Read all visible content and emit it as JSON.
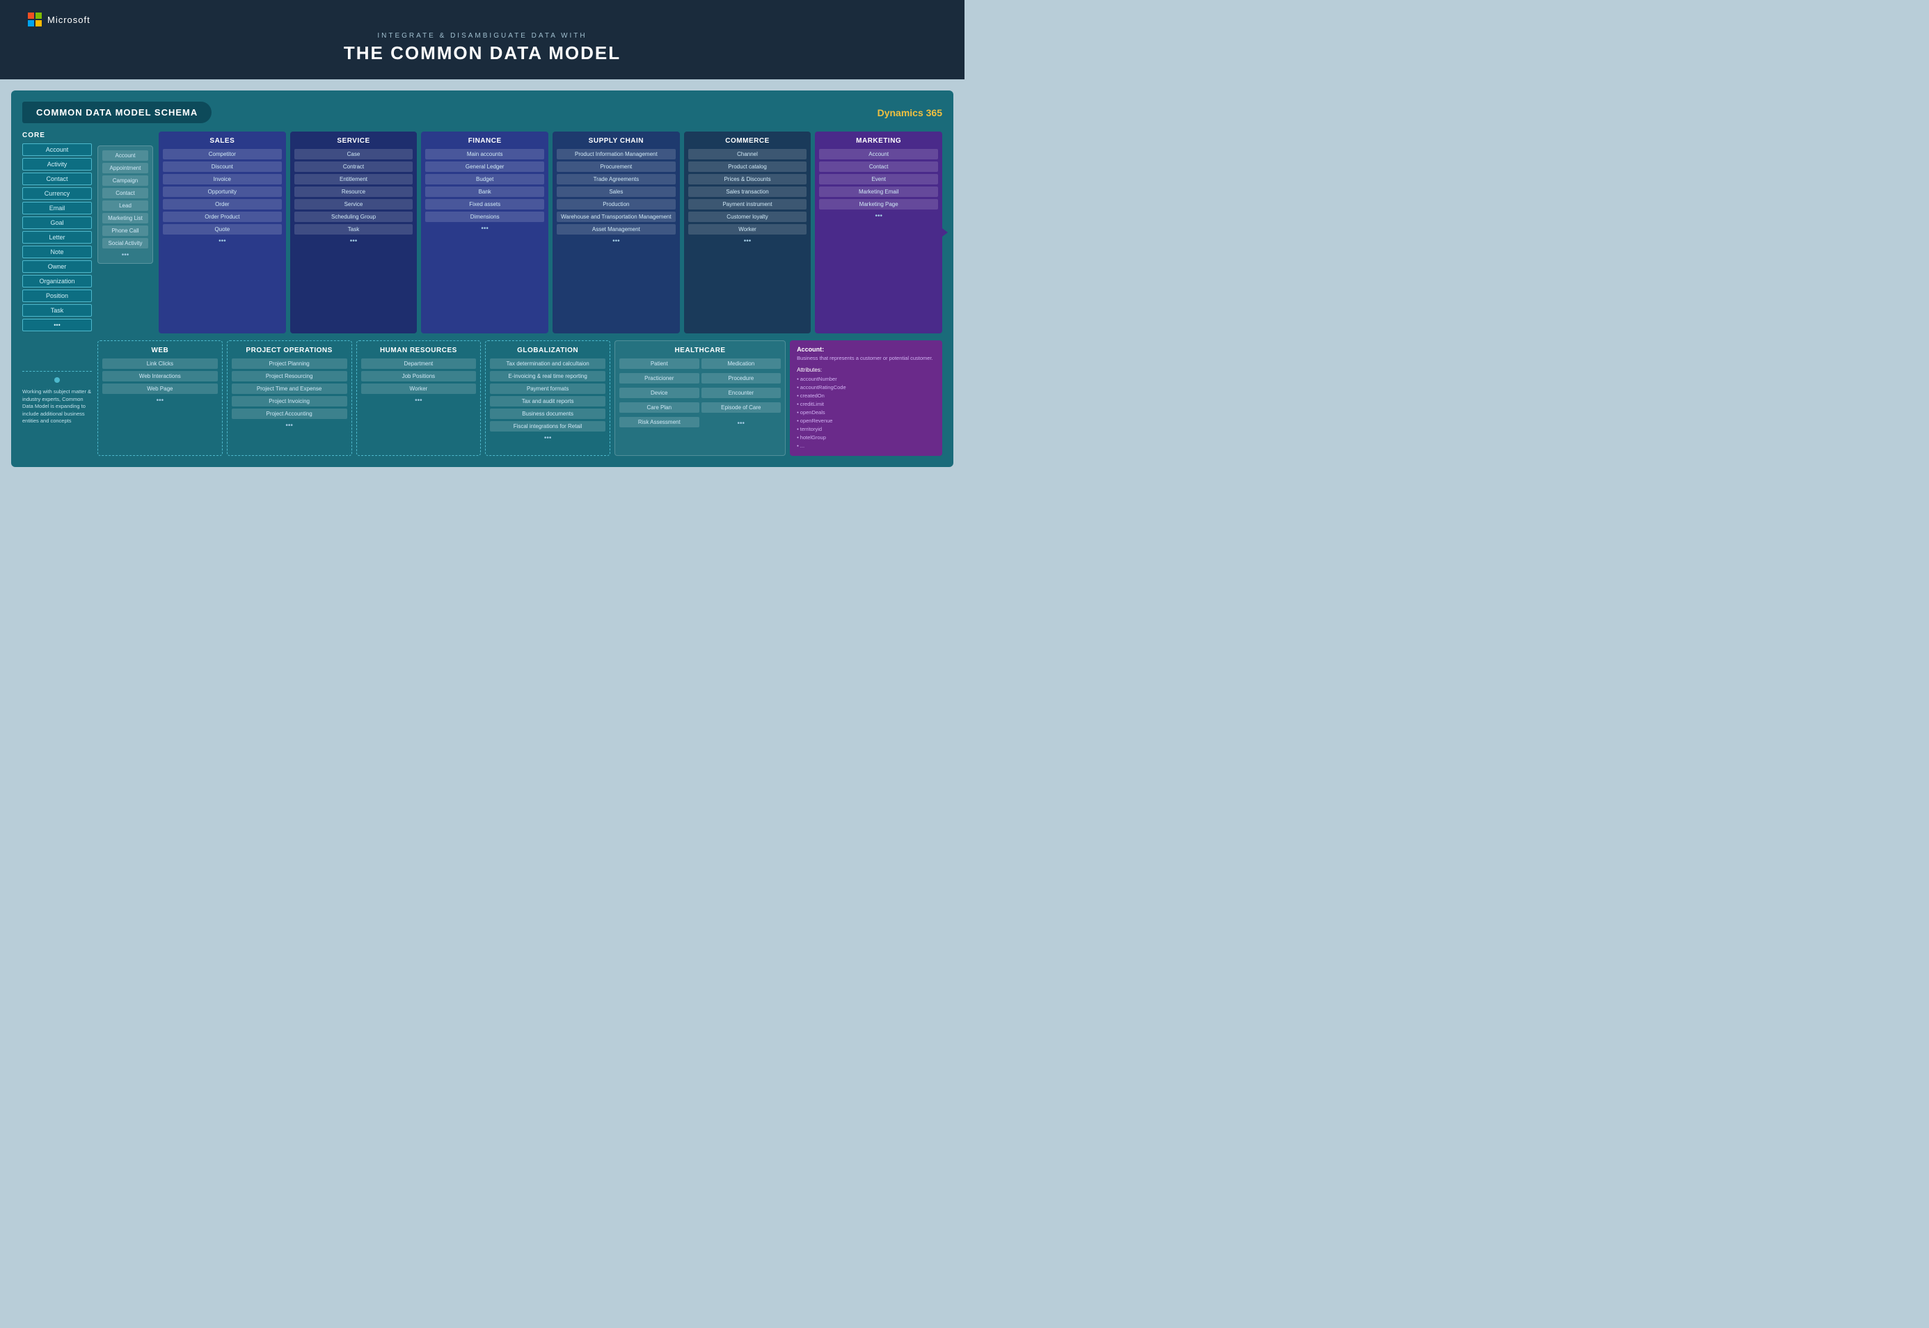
{
  "header": {
    "brand": "Microsoft",
    "subtitle": "Integrate & Disambiguate Data With",
    "title": "The Common Data Model"
  },
  "schema": {
    "title": "COMMON DATA MODEL SCHEMA",
    "dynamics_label": "Dynamics 365"
  },
  "core": {
    "label": "CORE",
    "items": [
      "Account",
      "Activity",
      "Contact",
      "Currency",
      "Email",
      "Goal",
      "Letter",
      "Note",
      "Owner",
      "Organization",
      "Position",
      "Task",
      "..."
    ]
  },
  "cds_base": {
    "items": [
      "Account",
      "Appointment",
      "Campaign",
      "Contact",
      "Lead",
      "Marketing List",
      "Phone Call",
      "Social Activity",
      "..."
    ]
  },
  "sales": {
    "title": "SALES",
    "items": [
      "Competitor",
      "Discount",
      "Invoice",
      "Opportunity",
      "Order",
      "Order Product",
      "Quote",
      "..."
    ]
  },
  "service": {
    "title": "SERVICE",
    "items": [
      "Case",
      "Contract",
      "Entitlement",
      "Resource",
      "Service",
      "Scheduling Group",
      "Task",
      "..."
    ]
  },
  "finance": {
    "title": "FINANCE",
    "items": [
      "Main accounts",
      "General Ledger",
      "Budget",
      "Bank",
      "Fixed assets",
      "Dimensions",
      "..."
    ]
  },
  "supply_chain": {
    "title": "SUPPLY CHAIN",
    "items": [
      "Product Information Management",
      "Procurement",
      "Trade Agreements",
      "Sales",
      "Production",
      "Warehouse and Transportation Management",
      "Asset Management",
      "..."
    ]
  },
  "commerce": {
    "title": "COMMERCE",
    "items": [
      "Channel",
      "Product catalog",
      "Prices & Discounts",
      "Sales transaction",
      "Payment instrument",
      "Customer loyalty",
      "Worker",
      "..."
    ]
  },
  "marketing": {
    "title": "MARKETING",
    "items": [
      "Account",
      "Contact",
      "Event",
      "Marketing Email",
      "Marketing Page",
      "..."
    ]
  },
  "web": {
    "title": "WEB",
    "items": [
      "Link Clicks",
      "Web Interactions",
      "Web Page",
      "..."
    ]
  },
  "project_ops": {
    "title": "PROJECT OPERATIONS",
    "items": [
      "Project Planning",
      "Project Resourcing",
      "Project Time and Expense",
      "Project Invoicing",
      "Project Accounting",
      "..."
    ]
  },
  "human_resources": {
    "title": "HUMAN RESOURCES",
    "items": [
      "Department",
      "Job Positions",
      "Worker",
      "..."
    ]
  },
  "globalization": {
    "title": "GLOBALIZATION",
    "items": [
      "Tax determination and calcuItaion",
      "E-invoicing & real time reporting",
      "Payment formats",
      "Tax and audit reports",
      "Business documents",
      "Fiscal integrations for Retail",
      "..."
    ]
  },
  "healthcare": {
    "title": "HEALTHCARE",
    "left_items": [
      "Patient",
      "Practicioner",
      "Device",
      "Care Plan",
      "Risk Assessment"
    ],
    "right_items": [
      "Medication",
      "Procedure",
      "Encounter",
      "Episode of Care",
      "..."
    ]
  },
  "account_tooltip": {
    "title": "Account:",
    "description": "Business that represents a customer or potential customer.",
    "attr_title": "Attributes:",
    "attributes": [
      "• accountNumber",
      "• accountRatingCode",
      "• createdOn",
      "• creditLimit",
      "• openDeals",
      "• openRevenue",
      "• territoryid",
      "• hotelGroup",
      "• ..."
    ]
  },
  "expansion": {
    "note": "Working with subject matter & industry experts, Common Data Model is expanding to include additional business entities and concepts"
  }
}
